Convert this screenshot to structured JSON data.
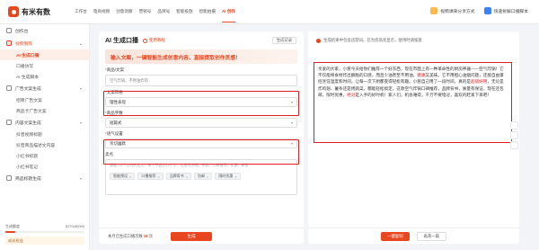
{
  "app": {
    "logo_text": "有米有数"
  },
  "nav": [
    "工作台",
    "电商视频",
    "创意洞察",
    "营销号",
    "品牌号",
    "智能投放",
    "智能拍摄",
    "AI 创作"
  ],
  "right_links": {
    "pricing": "视频课来分享方式",
    "buyer": "快速拆解口播脚本"
  },
  "sidebar": {
    "items": [
      {
        "label": "创作台",
        "type": "item"
      },
      {
        "label": "视频制作",
        "type": "group-open"
      },
      {
        "label": "AI 生成口播",
        "type": "sub",
        "active": true
      },
      {
        "label": "口播仿写",
        "type": "sub"
      },
      {
        "label": "AI 生成脚本",
        "type": "sub"
      },
      {
        "label": "广告文案生成",
        "type": "item"
      },
      {
        "label": "招商广告文案",
        "type": "sub"
      },
      {
        "label": "商品卡广告文案",
        "type": "sub"
      },
      {
        "label": "内容文案生成",
        "type": "item"
      },
      {
        "label": "抖音视频标题",
        "type": "sub"
      },
      {
        "label": "抖音商品描述文内容",
        "type": "sub"
      },
      {
        "label": "小红书标题",
        "type": "sub"
      },
      {
        "label": "小红书笔记",
        "type": "sub"
      },
      {
        "label": "商品标题生成",
        "type": "item"
      }
    ],
    "quota_label": "生成额度",
    "quota_value": "5270/40000",
    "quota_fraction": 0.13,
    "vip_text": "成长权益"
  },
  "form": {
    "title": "AI 生成口播",
    "help": "使用教程",
    "records": "生成记录",
    "banner": "输入文案，一键智能生成创意内容，直接提取创作灵感！",
    "fields": {
      "product": {
        "label": "商品/文案",
        "value": "空气炸锅，不用油炸的"
      },
      "style": {
        "label": "文案风格",
        "value": "理性表现"
      },
      "length": {
        "label": "商品字数",
        "value": "短篇式"
      },
      "tone": {
        "label": "语气设置",
        "value": "亲切幽默"
      },
      "keywords": {
        "label": "卖点",
        "hint": "请输入5个以内的卖点，每个不超过12个字，以逗号分隔，例如：口碑推荐，实惠，新鲜",
        "tags": [
          "智能预设",
          "口播推荐",
          "品牌背书",
          "包邮",
          "限时优惠"
        ]
      }
    },
    "usage": "本月已生成口播次数",
    "usage_count": "18",
    "usage_unit": "次",
    "generate": "生成"
  },
  "result": {
    "notice": "生成结果中包含违禁词，已为您高亮显示，使用时请留意",
    "segments": [
      {
        "t": "亲爱的大家，小葱今天给你们推荐一个好东西，现在市面上有一种革命性的厨房神器——空气炸锅！它不仅能将食材炸出酥脆的口感，而且少油甚至不用油，"
      },
      {
        "t": "健康",
        "red": true
      },
      {
        "t": "又美味。它不用担心油烟问题，还能自由掌控烹饪温度和时间，让每一次下厨都变得轻松有趣。小葱自己用了一段时间，真的是"
      },
      {
        "t": "超级好用",
        "red": true
      },
      {
        "t": "，无论是炸鸡翅、薯条还是烤蔬菜，都能轻松搞定。这款空气炸锅口碑推荐，品牌背书，质量有保证，现在还包邮，限时优惠，"
      },
      {
        "t": "绝对",
        "red": true
      },
      {
        "t": "是入手的好时机！家人们，机会难得，千万不要错过，喜欢的赶紧下单吧！"
      }
    ],
    "copy": "一键复制",
    "regenerate": "再来一篇"
  }
}
